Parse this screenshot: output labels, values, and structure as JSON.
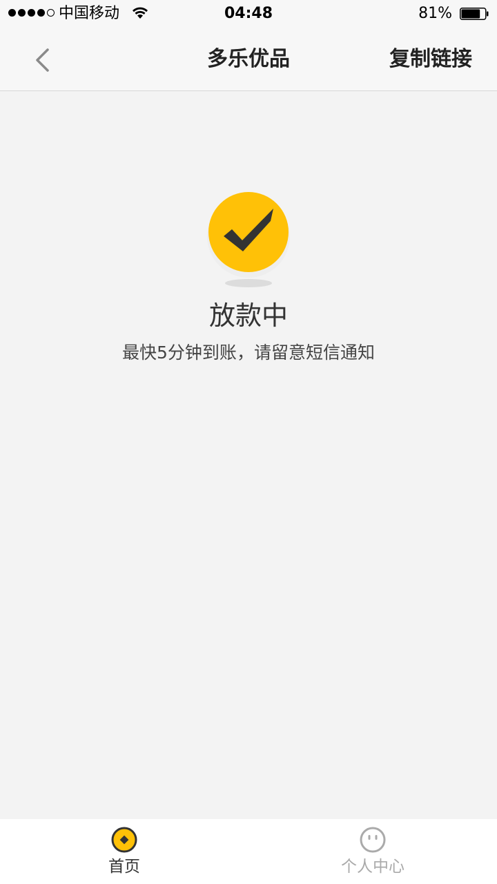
{
  "status_bar": {
    "carrier": "中国移动",
    "time": "04:48",
    "battery": "81%",
    "battery_level": 0.81
  },
  "nav": {
    "title": "多乐优品",
    "action": "复制链接",
    "back_icon": "chevron-left-icon"
  },
  "status": {
    "icon": "checkmark-icon",
    "title": "放款中",
    "subtitle": "最快5分钟到账，请留意短信通知"
  },
  "tabs": [
    {
      "label": "首页",
      "icon": "home-coin-icon",
      "active": true
    },
    {
      "label": "个人中心",
      "icon": "profile-face-icon",
      "active": false
    }
  ],
  "colors": {
    "accent": "#ffc107",
    "background": "#f3f3f3",
    "text_primary": "#333333",
    "tab_inactive": "#aaaaaa"
  }
}
